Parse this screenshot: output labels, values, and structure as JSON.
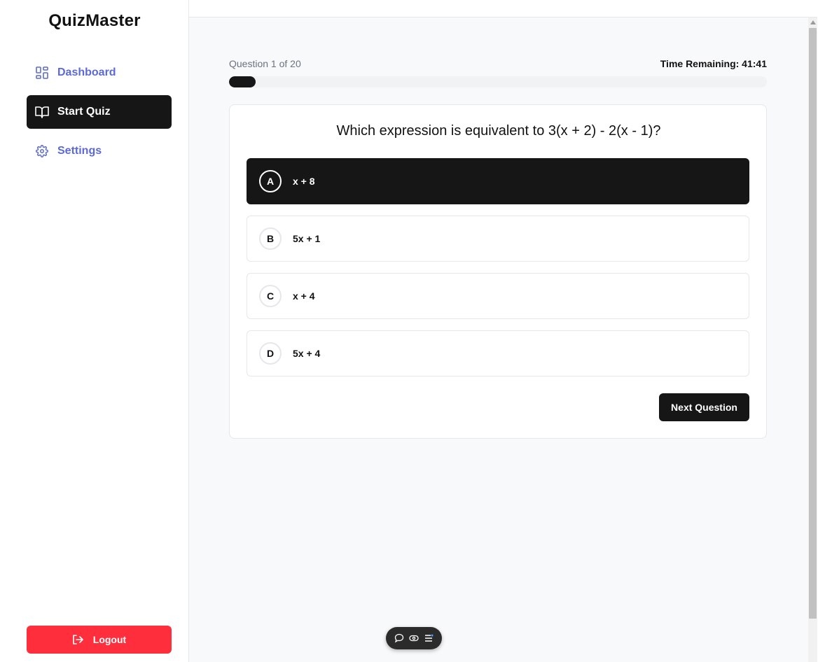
{
  "app": {
    "title": "QuizMaster"
  },
  "sidebar": {
    "items": [
      {
        "label": "Dashboard",
        "icon": "layout-grid-icon",
        "active": false
      },
      {
        "label": "Start Quiz",
        "icon": "book-open-icon",
        "active": true
      },
      {
        "label": "Settings",
        "icon": "gear-icon",
        "active": false
      }
    ],
    "logout_label": "Logout"
  },
  "quiz": {
    "question_counter": "Question 1 of 20",
    "time_remaining": "Time Remaining: 41:41",
    "progress_fraction": 0.05,
    "question_text": "Which expression is equivalent to 3(x + 2) - 2(x - 1)?",
    "options": [
      {
        "letter": "A",
        "text": "x + 8",
        "selected": true
      },
      {
        "letter": "B",
        "text": "5x + 1",
        "selected": false
      },
      {
        "letter": "C",
        "text": "x + 4",
        "selected": false
      },
      {
        "letter": "D",
        "text": "5x + 4",
        "selected": false
      }
    ],
    "next_label": "Next Question"
  },
  "colors": {
    "accent_nav": "#5b6ad8",
    "active_bg": "#161616",
    "logout_bg": "#ff2e3d"
  },
  "floating_toolbar": {
    "icons": [
      "comment-icon",
      "eye-icon",
      "menu-icon"
    ]
  }
}
